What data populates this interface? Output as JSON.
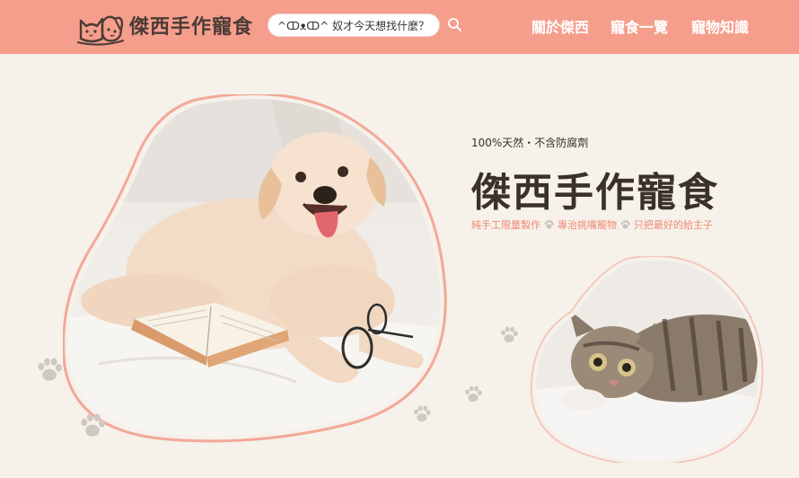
{
  "header": {
    "brand": "傑西手作寵食",
    "search": {
      "value": "^ↀᴥↀ^ 奴才今天想找什麼？",
      "placeholder": ""
    },
    "nav": [
      "關於傑西",
      "寵食一覽",
      "寵物知識"
    ]
  },
  "hero": {
    "tagline": "100%天然・不含防腐劑",
    "title": "傑西手作寵食",
    "features": [
      "純手工限量製作",
      "專治挑嘴寵物",
      "只把最好的給主子"
    ]
  },
  "colors": {
    "header_bg": "#f59e8c",
    "page_bg": "#f6f1ea",
    "accent": "#f08a73",
    "title": "#3a302c"
  },
  "icons": [
    "logo-cat-dog-icon",
    "search-icon",
    "paw-icon"
  ]
}
